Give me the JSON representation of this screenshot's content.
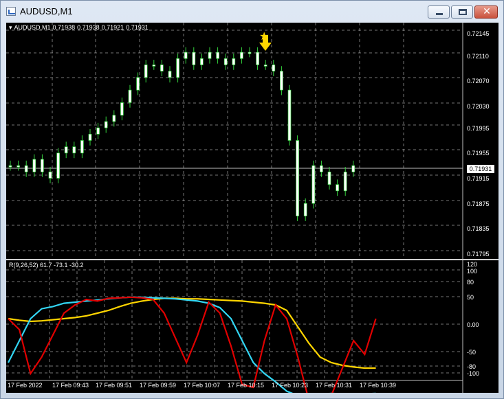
{
  "window": {
    "title": "AUDUSD,M1",
    "buttons": {
      "minimize": "minimize-icon",
      "maximize": "maximize-icon",
      "close": "close-icon"
    }
  },
  "main_chart": {
    "symbol": "AUDUSD,M1",
    "ohlc": [
      "0.71938",
      "0.71938",
      "0.71921",
      "0.71931"
    ],
    "price_labels": [
      "0.72145",
      "0.72110",
      "0.72070",
      "0.72030",
      "0.71995",
      "0.71955",
      "0.71915",
      "0.71875",
      "0.71835",
      "0.71795"
    ],
    "current_price": "0.71931",
    "time_labels": [
      "17 Feb 2022",
      "17 Feb 09:43",
      "17 Feb 09:51",
      "17 Feb 09:59",
      "17 Feb 10:07",
      "17 Feb 10:15",
      "17 Feb 10:23",
      "17 Feb 10:31",
      "17 Feb 10:39"
    ],
    "arrow_icon": "sell-arrow-icon",
    "colors": {
      "bull": "#ffffff",
      "bear": "#ffffff",
      "wick": "#33d33d",
      "arrow": "#ffd700",
      "grid": "#d8d8d8"
    }
  },
  "indicator": {
    "label": "R(9,26,52) 61.7 -73.1 -30.2",
    "ticks": [
      "120",
      "100",
      "80",
      "50",
      "0.00",
      "-50",
      "-80",
      "-100"
    ],
    "colors": {
      "fast": "#e00000",
      "mid": "#32d6f4",
      "slow": "#ffd500"
    }
  },
  "chart_data": {
    "type": "line",
    "title": "AUDUSD,M1",
    "xlabel": "",
    "ylabel": "",
    "x": [
      "17 Feb 2022",
      "17 Feb 09:43",
      "17 Feb 09:51",
      "17 Feb 09:59",
      "17 Feb 10:07",
      "17 Feb 10:15",
      "17 Feb 10:23",
      "17 Feb 10:31",
      "17 Feb 10:39"
    ],
    "ylim": [
      0.71795,
      0.72145
    ],
    "series": [
      {
        "values": [
          0.7193,
          0.7195,
          0.7197,
          0.72,
          0.7209,
          0.721,
          0.7211,
          0.7185,
          0.7193
        ]
      }
    ]
  }
}
